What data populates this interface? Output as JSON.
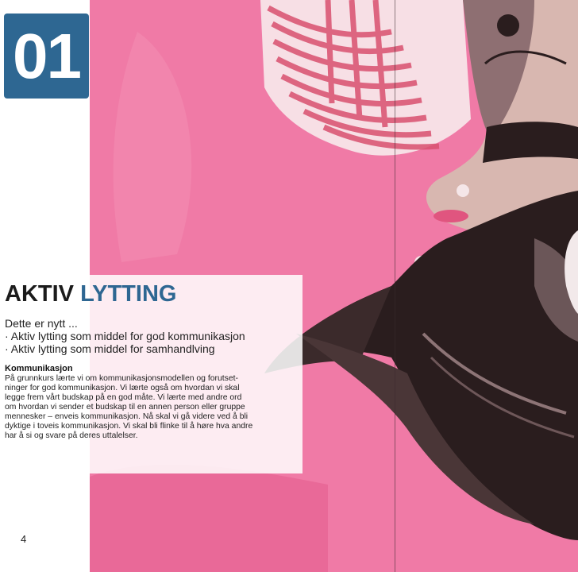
{
  "chapter": {
    "number": "01",
    "color": "#2e6792"
  },
  "title": {
    "part1": "AKTIV",
    "part2": "LYTTING"
  },
  "intro": {
    "lead": "Dette er nytt ...",
    "items": [
      "· Aktiv lytting som middel for god kommunikasjon",
      "· Aktiv lytting som middel for samhandlving"
    ]
  },
  "section": {
    "heading": "Kommunikasjon",
    "lines": [
      "På grunnkurs lærte vi om kommunikasjonsmodellen og forutset-",
      "ninger for god kommunikasjon. Vi lærte også om hvordan vi skal",
      "legge frem vårt budskap på en god måte. Vi lærte med andre ord",
      "om hvordan vi sender et budskap til en annen person eller gruppe",
      "mennesker – enveis kommunikasjon. Nå skal vi gå videre ved å bli",
      "dyktige i toveis kommunikasjon. Vi skal bli flinke til å høre hva andre",
      "har å si og svare på deres uttalelser."
    ]
  },
  "page_number": "4",
  "colors": {
    "background_pink": "#f07aa6",
    "hair": "#2a1d1e",
    "accent": "#2e6792"
  }
}
